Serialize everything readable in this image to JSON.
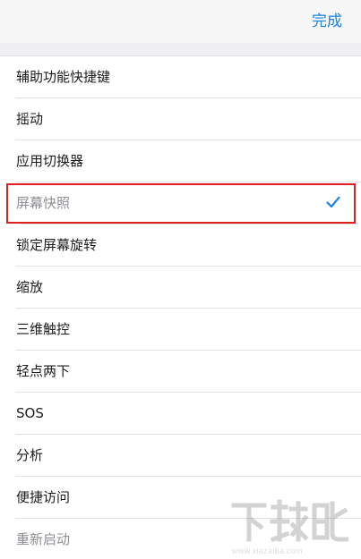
{
  "nav": {
    "done_label": "完成"
  },
  "items": [
    {
      "label": "辅助功能快捷键"
    },
    {
      "label": "摇动"
    },
    {
      "label": "应用切换器"
    },
    {
      "label": "屏幕快照",
      "selected": true
    },
    {
      "label": "锁定屏幕旋转"
    },
    {
      "label": "缩放"
    },
    {
      "label": "三维触控"
    },
    {
      "label": "轻点两下"
    },
    {
      "label": "SOS"
    },
    {
      "label": "分析"
    },
    {
      "label": "便捷访问"
    },
    {
      "label": "重新启动"
    }
  ],
  "watermark": {
    "url": "www.xiazaiba.com"
  },
  "colors": {
    "accent": "#1a82e2",
    "highlight_border": "#e02020"
  },
  "icons": {
    "checkmark": "checkmark-icon"
  }
}
